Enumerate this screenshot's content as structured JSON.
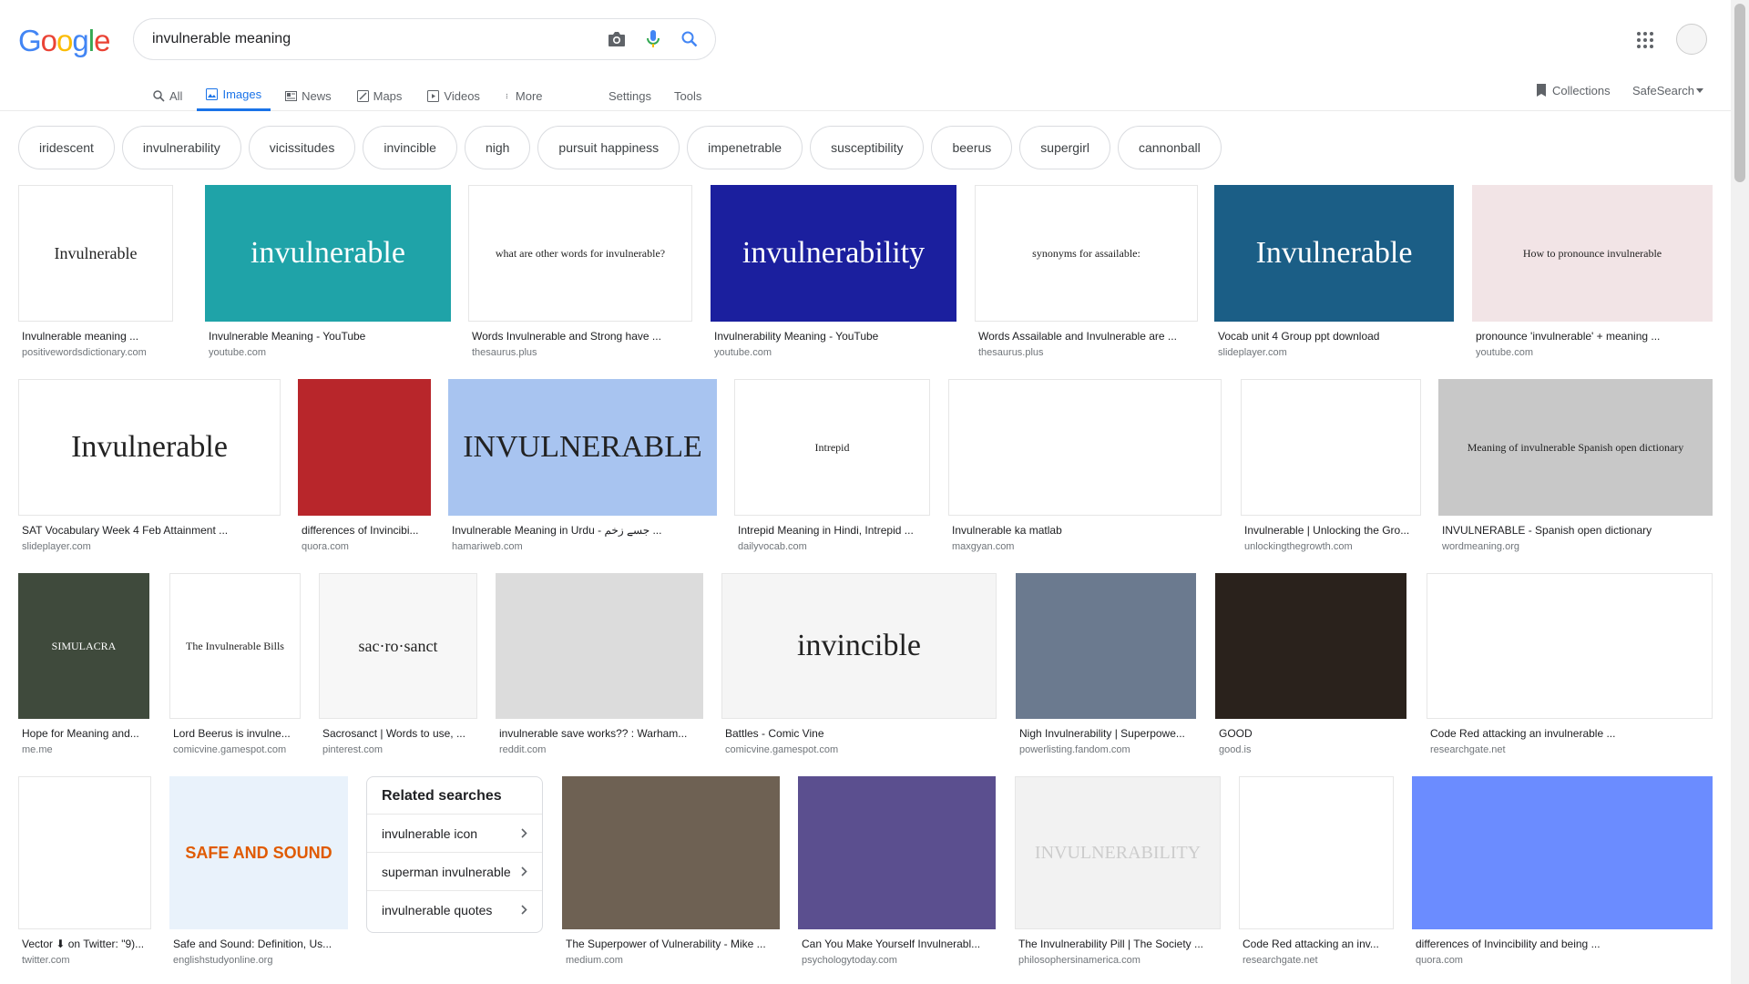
{
  "header": {
    "logo": "Google",
    "search_value": "invulnerable meaning",
    "tabs": [
      {
        "label": "All",
        "icon": "search-icon"
      },
      {
        "label": "Images",
        "icon": "image-icon"
      },
      {
        "label": "News",
        "icon": "news-icon"
      },
      {
        "label": "Maps",
        "icon": "map-icon"
      },
      {
        "label": "Videos",
        "icon": "video-icon"
      },
      {
        "label": "More",
        "icon": "more-vert-icon"
      }
    ],
    "settings": "Settings",
    "tools": "Tools",
    "collections": "Collections",
    "safesearch": "SafeSearch"
  },
  "chips": [
    "iridescent",
    "invulnerability",
    "vicissitudes",
    "invincible",
    "nigh",
    "pursuit happiness",
    "impenetrable",
    "susceptibility",
    "beerus",
    "supergirl",
    "cannonball"
  ],
  "results": [
    {
      "title": "Invulnerable meaning ...",
      "source": "positivewordsdictionary.com",
      "thumb_text": "Invulnerable",
      "bg": "#ffffff"
    },
    {
      "title": "Invulnerable Meaning - YouTube",
      "source": "youtube.com",
      "thumb_text": "invulnerable",
      "bg": "#1fa3a8"
    },
    {
      "title": "Words Invulnerable and Strong have ...",
      "source": "thesaurus.plus",
      "thumb_text": "what are other words for invulnerable?",
      "bg": "#ffffff"
    },
    {
      "title": "Invulnerability Meaning - YouTube",
      "source": "youtube.com",
      "thumb_text": "invulnerability",
      "bg": "#1b1f9e"
    },
    {
      "title": "Words Assailable and Invulnerable are ...",
      "source": "thesaurus.plus",
      "thumb_text": "synonyms for assailable:",
      "bg": "#ffffff"
    },
    {
      "title": "Vocab unit 4 Group ppt download",
      "source": "slideplayer.com",
      "thumb_text": "Invulnerable",
      "bg": "#1b5e86"
    },
    {
      "title": "pronounce 'invulnerable' + meaning ...",
      "source": "youtube.com",
      "thumb_text": "How to pronounce invulnerable",
      "bg": "#f2e4e6"
    },
    {
      "title": "SAT Vocabulary Week 4 Feb Attainment ...",
      "source": "slideplayer.com",
      "thumb_text": "Invulnerable",
      "bg": "#ffffff"
    },
    {
      "title": "differences of Invincibi...",
      "source": "quora.com",
      "thumb_text": "",
      "bg": "#b8262b"
    },
    {
      "title": "Invulnerable Meaning in Urdu - جسے زخم ...",
      "source": "hamariweb.com",
      "thumb_text": "INVULNERABLE",
      "bg": "#a8c4f0"
    },
    {
      "title": "Intrepid Meaning in Hindi, Intrepid ...",
      "source": "dailyvocab.com",
      "thumb_text": "Intrepid",
      "bg": "#ffffff"
    },
    {
      "title": "Invulnerable ka matlab",
      "source": "maxgyan.com",
      "thumb_text": "",
      "bg": "#ffffff"
    },
    {
      "title": "Invulnerable | Unlocking the Gro...",
      "source": "unlockingthegrowth.com",
      "thumb_text": "",
      "bg": "#ffffff"
    },
    {
      "title": "INVULNERABLE - Spanish open dictionary",
      "source": "wordmeaning.org",
      "thumb_text": "Meaning of invulnerable Spanish open dictionary",
      "bg": "#c8c8c8"
    },
    {
      "title": "Hope for Meaning and...",
      "source": "me.me",
      "thumb_text": "SIMULACRA",
      "bg": "#3f4a3c"
    },
    {
      "title": "Lord Beerus is invulne...",
      "source": "comicvine.gamespot.com",
      "thumb_text": "The Invulnerable Bills",
      "bg": "#ffffff"
    },
    {
      "title": "Sacrosanct | Words to use, ...",
      "source": "pinterest.com",
      "thumb_text": "sac·ro·sanct",
      "bg": "#f7f7f7"
    },
    {
      "title": "invulnerable save works?? : Warham...",
      "source": "reddit.com",
      "thumb_text": "",
      "bg": "#dcdcdc"
    },
    {
      "title": "Battles - Comic Vine",
      "source": "comicvine.gamespot.com",
      "thumb_text": "invincible",
      "bg": "#f5f5f5"
    },
    {
      "title": "Nigh Invulnerability | Superpowe...",
      "source": "powerlisting.fandom.com",
      "thumb_text": "",
      "bg": "#6b7a8f"
    },
    {
      "title": "GOOD",
      "source": "good.is",
      "thumb_text": "",
      "bg": "#2a221c"
    },
    {
      "title": "Code Red attacking an invulnerable ...",
      "source": "researchgate.net",
      "thumb_text": "",
      "bg": "#ffffff"
    },
    {
      "title": "Vector ⬇ on Twitter: \"9)...",
      "source": "twitter.com",
      "thumb_text": "",
      "bg": "#ffffff"
    },
    {
      "title": "Safe and Sound: Definition, Us...",
      "source": "englishstudyonline.org",
      "thumb_text": "SAFE AND SOUND",
      "bg": "#e9f2fb"
    },
    {
      "title": "The Superpower of Vulnerability - Mike ...",
      "source": "medium.com",
      "thumb_text": "",
      "bg": "#6e6153"
    },
    {
      "title": "Can You Make Yourself Invulnerabl...",
      "source": "psychologytoday.com",
      "thumb_text": "",
      "bg": "#5b4f8f"
    },
    {
      "title": "The Invulnerability Pill | The Society ...",
      "source": "philosophersinamerica.com",
      "thumb_text": "INVULNERABILITY",
      "bg": "#f2f2f2"
    },
    {
      "title": "Code Red attacking an inv...",
      "source": "researchgate.net",
      "thumb_text": "",
      "bg": "#ffffff"
    },
    {
      "title": "differences of Invincibility and being ...",
      "source": "quora.com",
      "thumb_text": "",
      "bg": "#6b8cff"
    }
  ],
  "related": {
    "title": "Related searches",
    "items": [
      "invulnerable icon",
      "superman invulnerable",
      "invulnerable quotes"
    ]
  }
}
